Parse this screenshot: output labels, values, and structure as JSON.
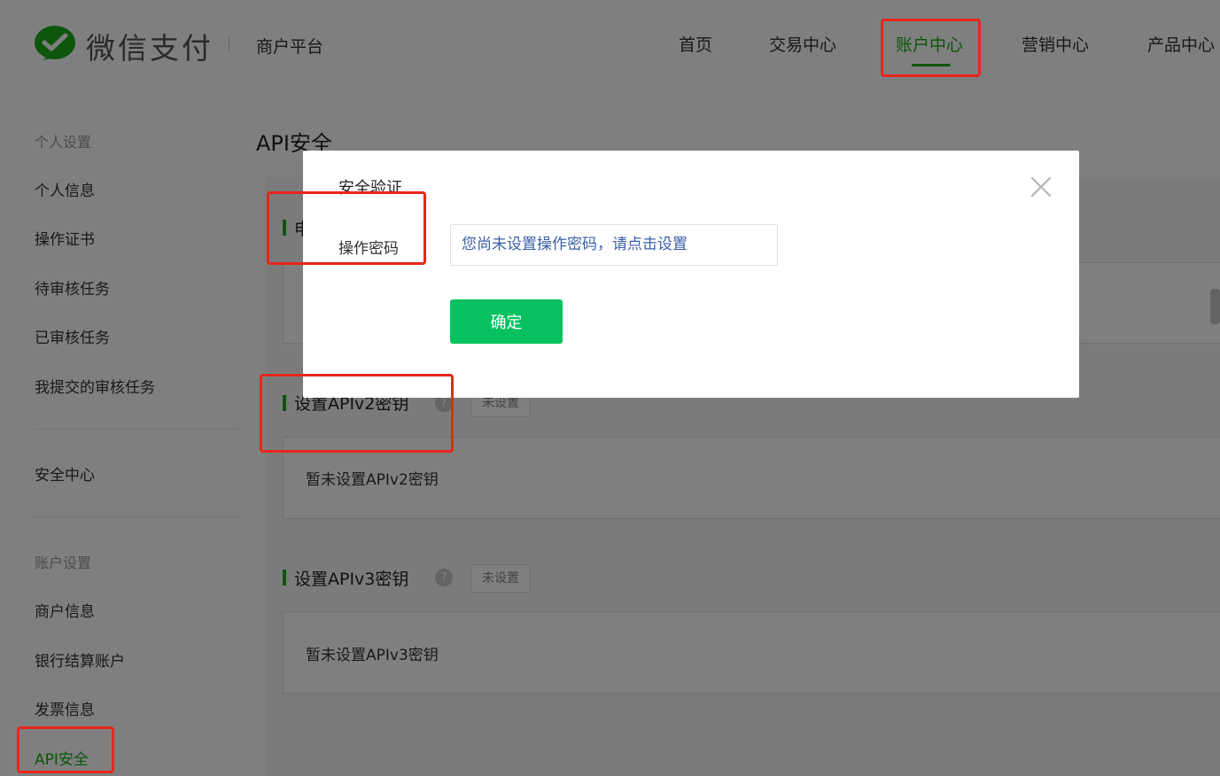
{
  "header": {
    "logo_text": "微信支付",
    "platform": "商户平台",
    "nav": [
      "首页",
      "交易中心",
      "账户中心",
      "营销中心",
      "产品中心"
    ],
    "active_nav": "账户中心"
  },
  "sidebar": {
    "section_personal": "个人设置",
    "personal_items": [
      "个人信息",
      "操作证书",
      "待审核任务",
      "已审核任务",
      "我提交的审核任务"
    ],
    "security": "安全中心",
    "section_account": "账户设置",
    "account_items": [
      "商户信息",
      "银行结算账户",
      "发票信息",
      "API安全"
    ],
    "active_item": "API安全"
  },
  "main": {
    "page_title": "API安全",
    "section_cert_partial": "申",
    "sections": [
      {
        "title": "设置APIv2密钥",
        "help": "?",
        "badge": "未设置",
        "content": "暂未设置APIv2密钥"
      },
      {
        "title": "设置APIv3密钥",
        "help": "?",
        "badge": "未设置",
        "content": "暂未设置APIv3密钥"
      }
    ]
  },
  "modal": {
    "title": "安全验证",
    "field_label": "操作密码",
    "field_link": "您尚未设置操作密码，请点击设置",
    "confirm": "确定",
    "close_icon": "close-icon"
  },
  "colors": {
    "brand_green": "#1aad19",
    "button_green": "#07c160",
    "link_blue": "#3a5fa8",
    "highlight_red": "#e8261c"
  }
}
